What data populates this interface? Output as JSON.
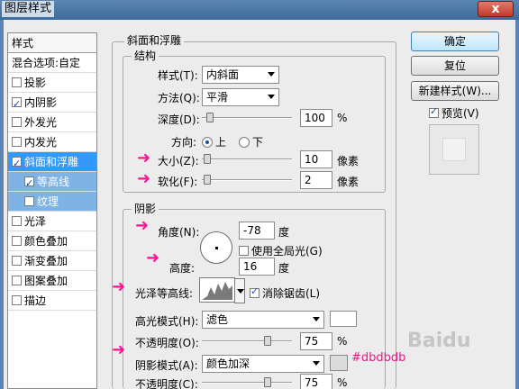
{
  "window": {
    "title": "图层样式",
    "close_glyph": "x"
  },
  "sidebar": {
    "header": "样式",
    "items": [
      {
        "label": "混合选项:自定",
        "checkbox": false,
        "checked": false
      },
      {
        "label": "投影",
        "checkbox": true,
        "checked": false
      },
      {
        "label": "内阴影",
        "checkbox": true,
        "checked": true
      },
      {
        "label": "外发光",
        "checkbox": true,
        "checked": false
      },
      {
        "label": "内发光",
        "checkbox": true,
        "checked": false
      },
      {
        "label": "斜面和浮雕",
        "checkbox": true,
        "checked": true,
        "selected": true
      },
      {
        "label": "等高线",
        "checkbox": true,
        "checked": true,
        "sub": true
      },
      {
        "label": "纹理",
        "checkbox": true,
        "checked": false,
        "sub": true
      },
      {
        "label": "光泽",
        "checkbox": true,
        "checked": false
      },
      {
        "label": "颜色叠加",
        "checkbox": true,
        "checked": false
      },
      {
        "label": "渐变叠加",
        "checkbox": true,
        "checked": false
      },
      {
        "label": "图案叠加",
        "checkbox": true,
        "checked": false
      },
      {
        "label": "描边",
        "checkbox": true,
        "checked": false
      }
    ]
  },
  "bevel": {
    "section_title": "斜面和浮雕",
    "structure": {
      "title": "结构",
      "style_label": "样式(T):",
      "style_value": "内斜面",
      "technique_label": "方法(Q):",
      "technique_value": "平滑",
      "depth_label": "深度(D):",
      "depth_value": "100",
      "depth_unit": "%",
      "direction_label": "方向:",
      "dir_up": "上",
      "dir_down": "下",
      "size_label": "大小(Z):",
      "size_value": "10",
      "size_unit": "像素",
      "soften_label": "软化(F):",
      "soften_value": "2",
      "soften_unit": "像素"
    },
    "shading": {
      "title": "阴影",
      "angle_label": "角度(N):",
      "angle_value": "-78",
      "angle_unit": "度",
      "global_light_label": "使用全局光(G)",
      "altitude_label": "高度:",
      "altitude_value": "16",
      "altitude_unit": "度",
      "gloss_contour_label": "光泽等高线:",
      "anti_alias_label": "消除锯齿(L)",
      "highlight_mode_label": "高光模式(H):",
      "highlight_mode_value": "滤色",
      "highlight_opacity_label": "不透明度(O):",
      "highlight_opacity_value": "75",
      "highlight_opacity_unit": "%",
      "shadow_mode_label": "阴影模式(A):",
      "shadow_mode_value": "颜色加深",
      "shadow_opacity_label": "不透明度(C):",
      "shadow_opacity_value": "75",
      "shadow_opacity_unit": "%"
    },
    "annotation": "#dbdbdb"
  },
  "buttons": {
    "ok": "确定",
    "reset": "复位",
    "new_style": "新建样式(W)...",
    "preview_label": "预览(V)"
  },
  "colors": {
    "highlight_color": "#ffffff",
    "shadow_color": "#dbdbdb",
    "accent": "#ff1493",
    "selection": "#3399ff"
  },
  "slider_levels": {
    "depth": 0.05,
    "size": 0.02,
    "soften": 0.02,
    "highlight_opacity": 0.75,
    "shadow_opacity": 0.75
  }
}
